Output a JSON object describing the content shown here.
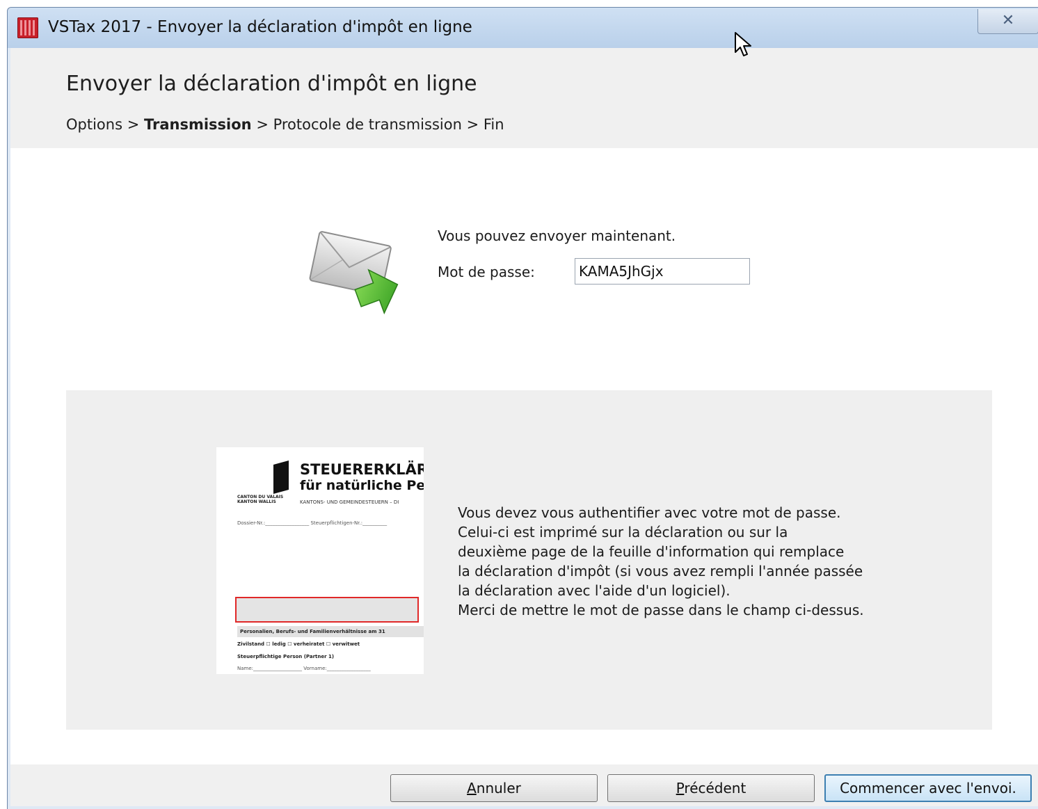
{
  "window": {
    "title": "VSTax 2017 - Envoyer la déclaration d'impôt en ligne",
    "close_glyph": "✕"
  },
  "header": {
    "title": "Envoyer la déclaration d'impôt en ligne",
    "breadcrumb": {
      "step1": "Options",
      "sep1": " > ",
      "step2": "Transmission",
      "sep2": " > ",
      "step3": "Protocole de transmission",
      "sep3": " > ",
      "step4": "Fin"
    }
  },
  "main": {
    "ready_text": "Vous pouvez envoyer maintenant.",
    "password_label": "Mot de passe:",
    "password_value": "KAMA5JhGjx"
  },
  "info": {
    "lines": [
      "Vous devez vous authentifier avec votre mot de passe.",
      "Celui-ci est imprimé sur la déclaration ou sur la",
      "deuxième page de la feuille d'information qui remplace",
      "la déclaration d'impôt (si vous avez rempli l'année passée",
      "la déclaration avec l'aide d'un logiciel).",
      "Merci de mettre le mot de passe dans le champ ci-dessus."
    ],
    "document_preview": {
      "title_line1": "STEUERERKLÄR",
      "title_line2": "für natürliche Pers",
      "subtitle": "KANTONS- UND GEMEINDESTEUERN – DI",
      "canton_line1": "CANTON DU VALAIS",
      "canton_line2": "KANTON WALLIS",
      "field_row": "Dossier-Nr.:__________________ Steuerpflichtigen-Nr.:__________",
      "section_header": "Personalien, Berufs- und Familienverhältnisse am 31",
      "row_civil": "Zivilstand      ☐ ledig          ☐ verheiratet       ☐ verwitwet",
      "row_person": "Steuerpflichtige Person  (Partner 1)",
      "row_name": "Name:____________________ Vorname:__________________"
    }
  },
  "footer": {
    "cancel_label_first": "A",
    "cancel_label_rest": "nnuler",
    "previous_label_first": "P",
    "previous_label_rest": "récédent",
    "start_label": "Commencer avec l'envoi."
  },
  "colors": {
    "titlebar": "#c4d8ef",
    "header_band": "#f0f0f0",
    "info_panel": "#efefef",
    "primary_button_border": "#3c7fb1",
    "highlight_red": "#e02828"
  },
  "icons": [
    "app-icon",
    "close-icon",
    "mouse-cursor-icon",
    "send-mail-icon"
  ]
}
